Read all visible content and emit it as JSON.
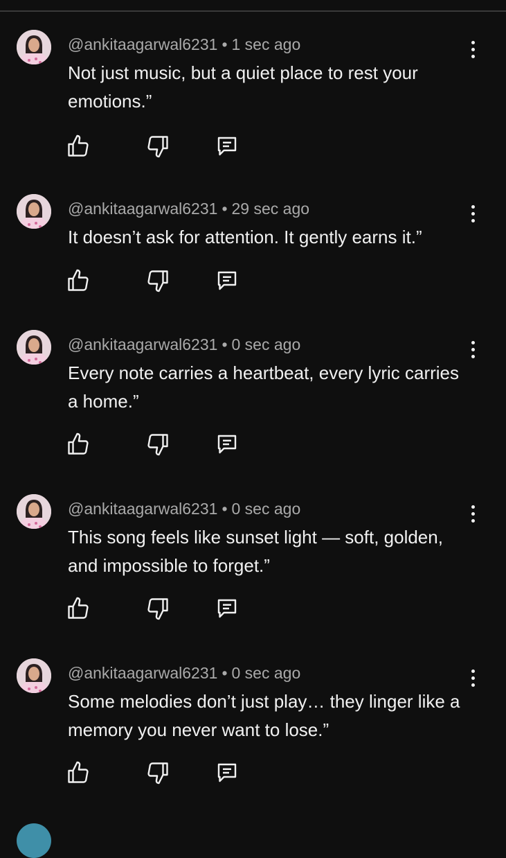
{
  "comments": [
    {
      "handle": "@ankitaagarwal6231",
      "separator": "•",
      "time": "1 sec ago",
      "text": "Not just music, but a quiet place to rest your emotions.”"
    },
    {
      "handle": "@ankitaagarwal6231",
      "separator": "•",
      "time": "29 sec ago",
      "text": "It doesn’t ask for attention. It gently earns it.”"
    },
    {
      "handle": "@ankitaagarwal6231",
      "separator": "•",
      "time": "0 sec ago",
      "text": "Every note carries a heartbeat, every lyric carries a home.”"
    },
    {
      "handle": "@ankitaagarwal6231",
      "separator": "•",
      "time": "0 sec ago",
      "text": "This song feels like sunset light — soft, golden, and impossible to forget.”"
    },
    {
      "handle": "@ankitaagarwal6231",
      "separator": "•",
      "time": "0 sec ago",
      "text": "Some melodies don’t just play… they linger like a memory you never want to lose.”"
    }
  ],
  "icons": {
    "like": "thumbs-up-icon",
    "dislike": "thumbs-down-icon",
    "reply": "comment-reply-icon",
    "menu": "more-vertical-icon"
  },
  "colors": {
    "background": "#0f0f0f",
    "text": "#f1f1f1",
    "meta": "#aaaaaa"
  }
}
